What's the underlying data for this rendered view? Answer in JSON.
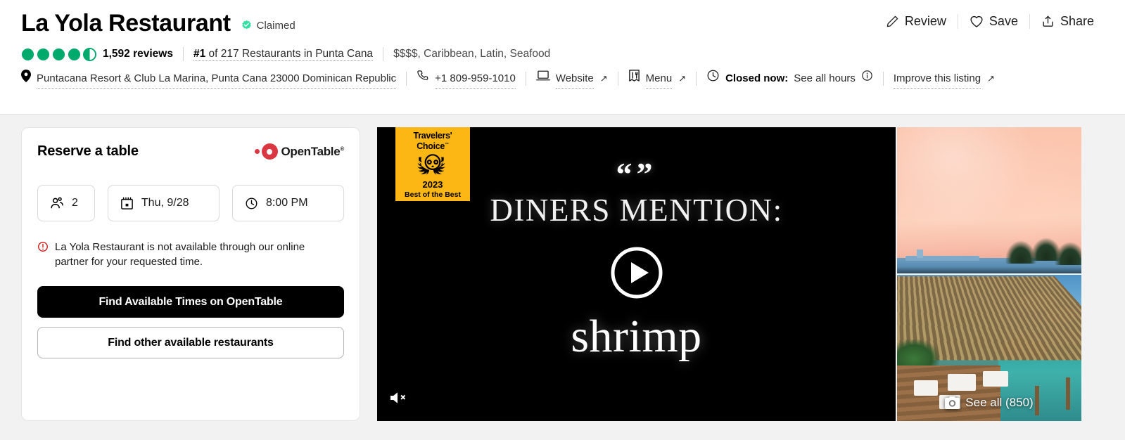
{
  "header": {
    "title": "La Yola Restaurant",
    "claimed_label": "Claimed",
    "claimed_icon": "verified-badge-icon",
    "actions": [
      {
        "label": "Review",
        "icon": "pencil-icon"
      },
      {
        "label": "Save",
        "icon": "heart-icon"
      },
      {
        "label": "Share",
        "icon": "share-icon"
      }
    ],
    "rating": {
      "value": 4.5,
      "bubbles_total": 5,
      "reviews_count": "1,592 reviews",
      "bubble_color": "#00aa6c"
    },
    "rank_prefix": "#1",
    "rank_suffix": " of 217 Restaurants in Punta Cana",
    "cuisine": "$$$$, Caribbean, Latin, Seafood",
    "address": "Puntacana Resort & Club La Marina, Punta Cana 23000 Dominican Republic",
    "address_icon": "map-pin-icon",
    "phone": "+1 809-959-1010",
    "phone_icon": "phone-icon",
    "website_label": "Website",
    "website_icon": "laptop-icon",
    "menu_label": "Menu",
    "menu_icon": "menu-card-icon",
    "clock_icon": "clock-icon",
    "status_label": "Closed now:",
    "hours_link": "See all hours",
    "info_icon": "info-circle-icon",
    "improve_label": "Improve this listing",
    "external_arrow": "↗"
  },
  "reserve": {
    "title": "Reserve a table",
    "partner_name": "OpenTable",
    "partner_trademark": "®",
    "partner_color": "#da3743",
    "party_size": "2",
    "party_icon": "people-icon",
    "date": "Thu, 9/28",
    "date_icon": "calendar-icon",
    "time": "8:00 PM",
    "time_icon": "clock-icon",
    "warning_icon": "alert-circle-icon",
    "warning_color": "#cc0000",
    "warning_text": "La Yola Restaurant is not available through our online partner for your requested time.",
    "primary_button": "Find Available Times on OpenTable",
    "secondary_button": "Find other available restaurants"
  },
  "media": {
    "badge": {
      "line1": "Travelers'",
      "line2": "Choice",
      "trademark": "™",
      "year": "2023",
      "line4": "Best of the Best",
      "background": "#fdb714",
      "icon": "tripadvisor-owl-icon"
    },
    "video": {
      "quote_marks": "“”",
      "caption_line1": "DINERS MENTION:",
      "caption_line2": "shrimp",
      "play_icon": "play-circle-icon",
      "mute_icon": "speaker-muted-icon"
    },
    "photos": {
      "see_all_label": "See all (850)",
      "see_all_icon": "camera-icon"
    }
  }
}
